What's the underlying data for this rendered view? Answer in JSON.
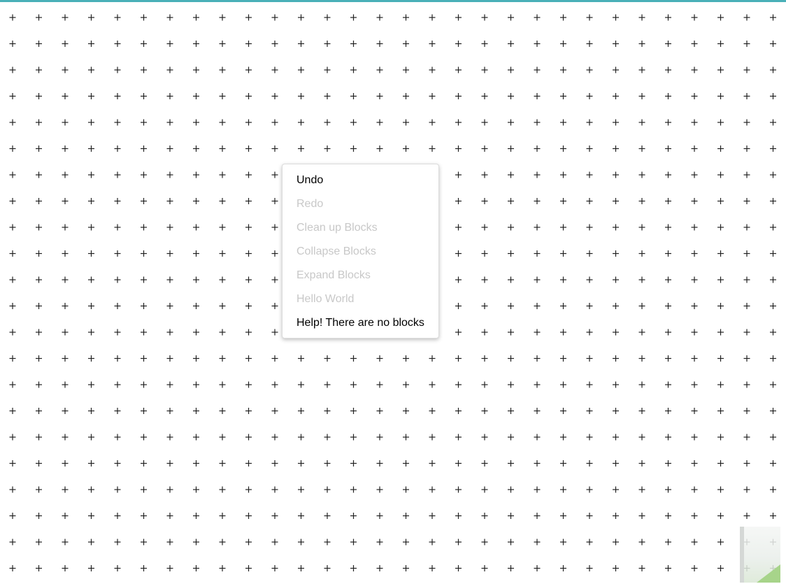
{
  "theme": {
    "accent": "#4ab0b8",
    "grid_color": "#222222",
    "disabled_text": "#c8c8c8"
  },
  "workspace": {
    "grid_symbol": "+"
  },
  "context_menu": {
    "items": [
      {
        "label": "Undo",
        "enabled": true
      },
      {
        "label": "Redo",
        "enabled": false
      },
      {
        "label": "Clean up Blocks",
        "enabled": false
      },
      {
        "label": "Collapse Blocks",
        "enabled": false
      },
      {
        "label": "Expand Blocks",
        "enabled": false
      },
      {
        "label": "Hello World",
        "enabled": false
      },
      {
        "label": "Help! There are no blocks",
        "enabled": true
      }
    ]
  }
}
